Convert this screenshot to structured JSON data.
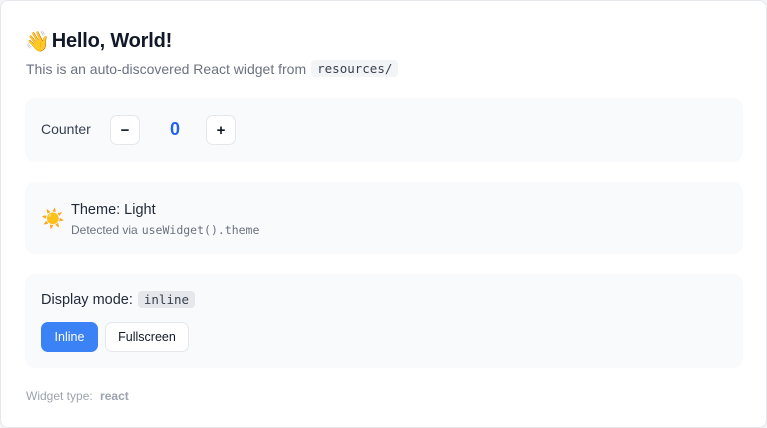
{
  "header": {
    "wave_icon": "👋",
    "title": "Hello, World!",
    "subtitle": "This is an auto-discovered React widget from",
    "subtitle_code": "resources/"
  },
  "counter": {
    "label": "Counter",
    "decrement_label": "−",
    "increment_label": "+",
    "value": "0"
  },
  "theme": {
    "icon": "☀️",
    "title": "Theme: Light",
    "detected_text": "Detected via",
    "detected_code": "useWidget().theme"
  },
  "display": {
    "label": "Display mode:",
    "mode_code": "inline",
    "buttons": {
      "inline": "Inline",
      "fullscreen": "Fullscreen"
    },
    "active_color": "#3b82f6"
  },
  "footer": {
    "label": "Widget type:",
    "value": "react"
  }
}
